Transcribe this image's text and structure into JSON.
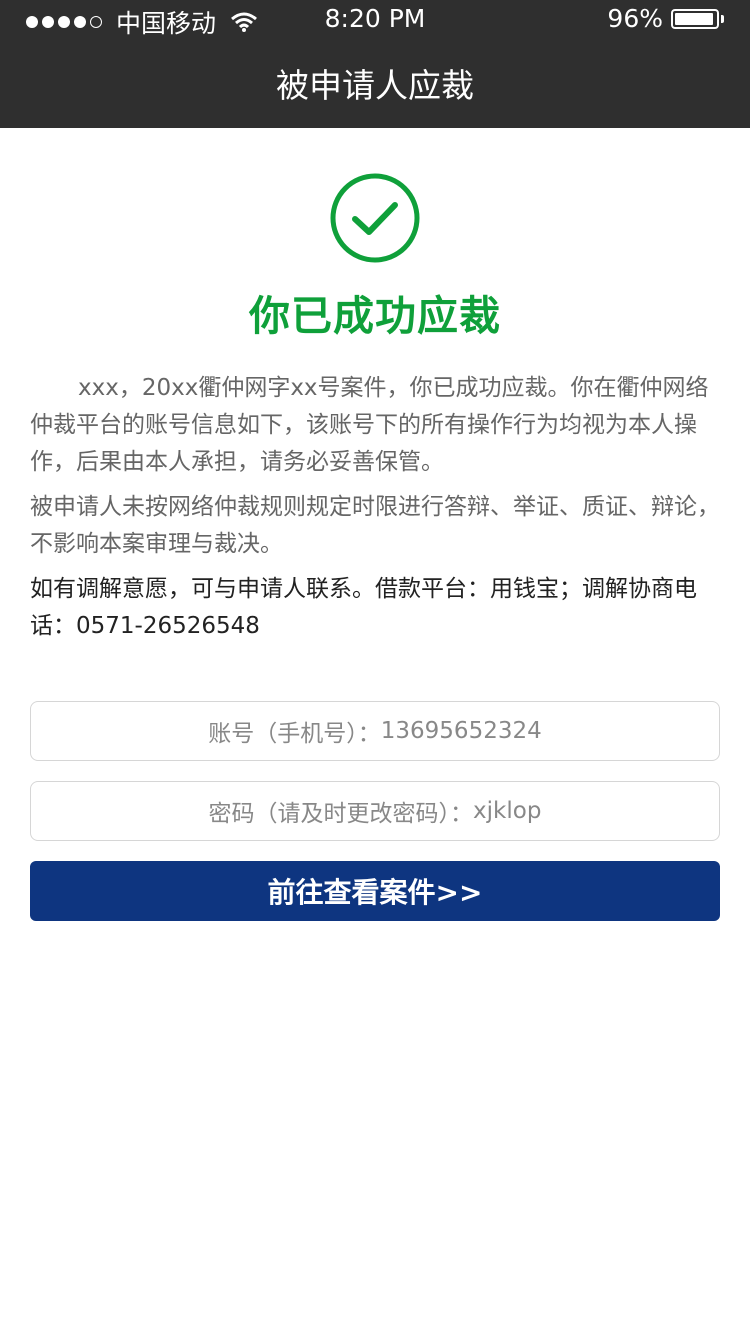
{
  "status_bar": {
    "carrier": "中国移动",
    "time": "8:20 PM",
    "battery": "96%",
    "battery_level": 0.96
  },
  "header": {
    "title": "被申请人应裁"
  },
  "success": {
    "icon": "check-circle-icon",
    "title": "你已成功应裁",
    "color": "#0fa03a"
  },
  "paragraphs": [
    "xxx，20xx衢仲网字xx号案件，你已成功应裁。你在衢仲网络仲裁平台的账号信息如下，该账号下的所有操作行为均视为本人操作，后果由本人承担，请务必妥善保管。",
    "被申请人未按网络仲裁规则规定时限进行答辩、举证、质证、辩论，不影响本案审理与裁决。",
    "如有调解意愿，可与申请人联系。借款平台：用钱宝；调解协商电话：0571-26526548"
  ],
  "account": {
    "label": "账号（手机号）：",
    "value": "13695652324"
  },
  "password": {
    "label": "密码（请及时更改密码）：",
    "value": "xjklop"
  },
  "button": {
    "label": "前往查看案件>>",
    "color": "#0e3580"
  }
}
